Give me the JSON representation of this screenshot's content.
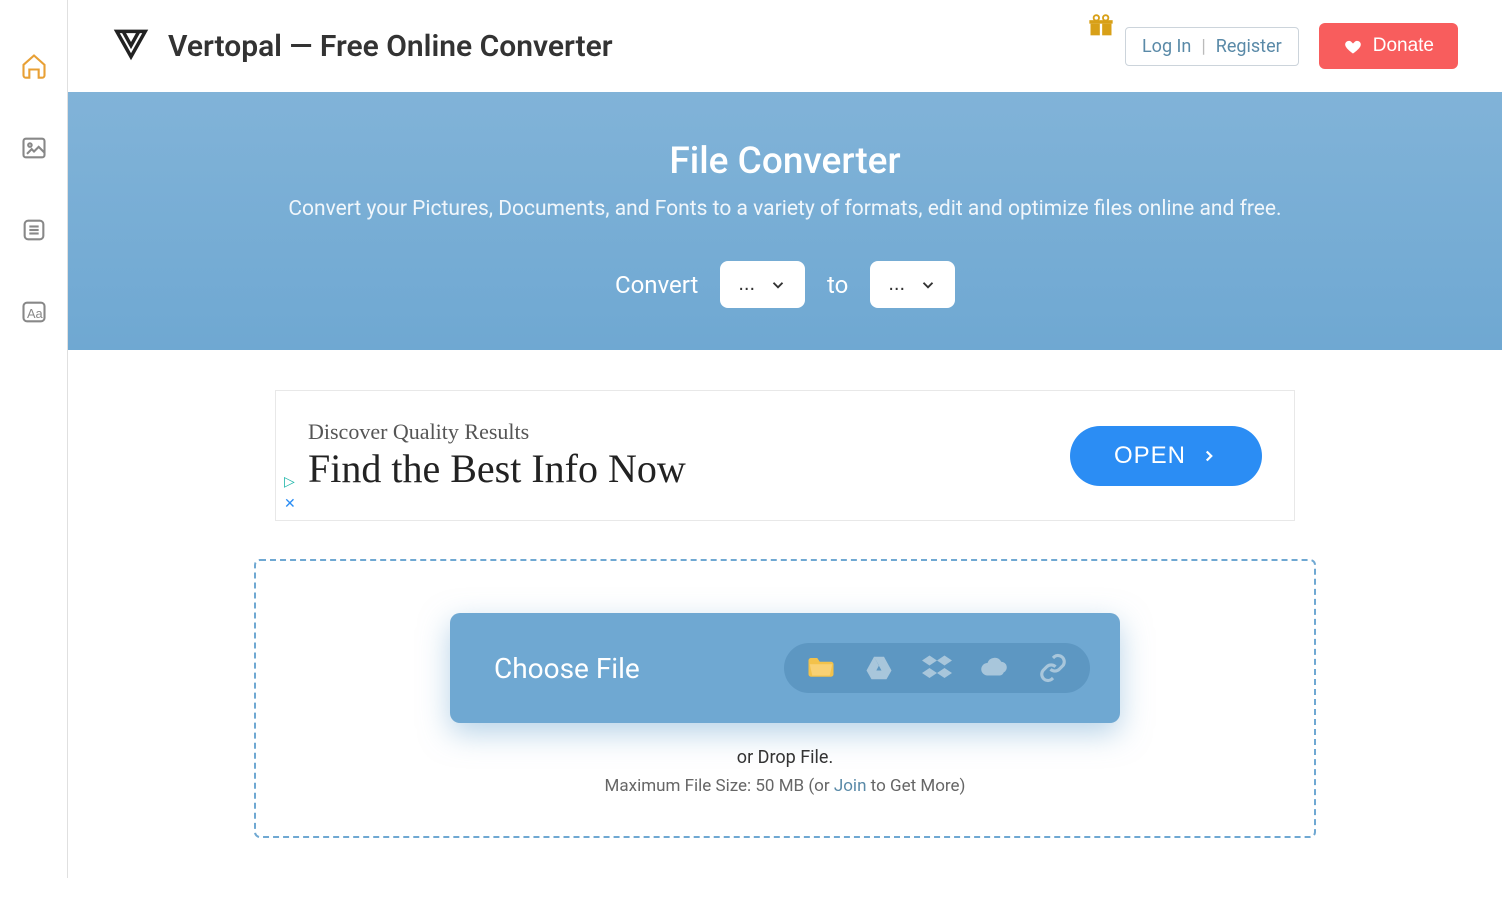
{
  "header": {
    "title": "Vertopal — Free Online Converter",
    "login": "Log In",
    "register": "Register",
    "donate": "Donate"
  },
  "hero": {
    "title": "File Converter",
    "subtitle": "Convert your Pictures, Documents, and Fonts to a variety of formats, edit and optimize files online and free.",
    "convert_label": "Convert",
    "to_label": "to",
    "from_placeholder": "...",
    "to_placeholder": "..."
  },
  "ad": {
    "sub": "Discover Quality Results",
    "main": "Find the Best Info Now",
    "button": "OPEN"
  },
  "dropzone": {
    "choose": "Choose File",
    "drop_text": "or Drop File.",
    "max_prefix": "Maximum File Size: 50 MB (or ",
    "join": "Join",
    "max_suffix": " to Get More)"
  }
}
